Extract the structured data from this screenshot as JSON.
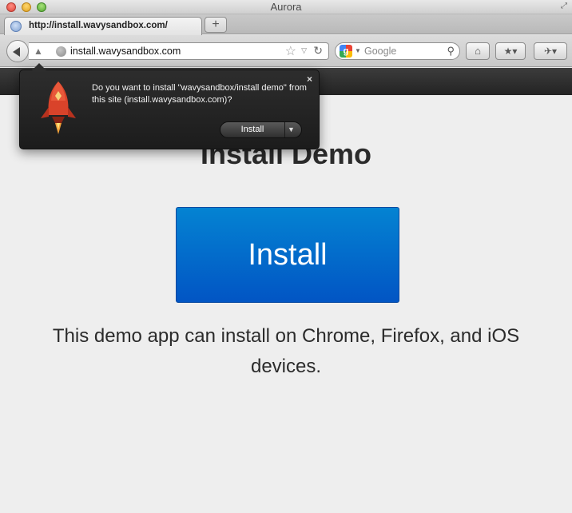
{
  "window": {
    "title": "Aurora"
  },
  "tab": {
    "title": "http://install.wavysandbox.com/",
    "close_glyph": "/",
    "new_tab_glyph": "+"
  },
  "nav": {
    "url_domain": "install.wavysandbox.com",
    "search_placeholder": "Google",
    "search_engine_icon": "google-icon",
    "home_glyph": "⌂",
    "bookmarks_glyph": "★▾",
    "extensions_glyph": "✈▾"
  },
  "popup": {
    "message": "Do you want to install \"wavysandbox/install demo\" from this site (install.wavysandbox.com)?",
    "close_glyph": "×",
    "install_label": "Install",
    "install_drop_glyph": "▼"
  },
  "page": {
    "title": "Install Demo",
    "install_button": "Install",
    "description": "This demo app can install on Chrome, Firefox, and iOS devices."
  },
  "colors": {
    "install_button": "#0366cc",
    "popup_bg": "#262626",
    "header_band": "#2e2e2e",
    "page_bg": "#eeeeee"
  }
}
